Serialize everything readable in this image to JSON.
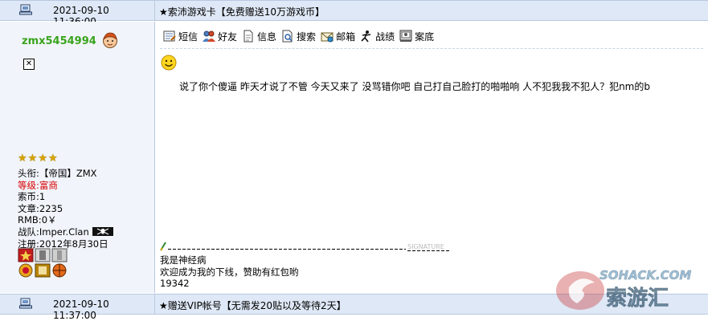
{
  "header_top": {
    "date": "2021-09-10 11:36:00",
    "title": "★索沛游戏卡【免费赠送10万游戏币】"
  },
  "header_bottom": {
    "date": "2021-09-10 11:37:00",
    "title": "★赠送VIP帐号【无需发20贴以及等待2天】"
  },
  "user": {
    "name": "zmx5454994",
    "stars": [
      "★",
      "★",
      "★",
      "★"
    ],
    "broken_image_mark": "✕",
    "info": [
      {
        "label": "头衔:",
        "value": "【帝国】ZMX",
        "highlight": false
      },
      {
        "label": "等级:",
        "value": "富商",
        "highlight": true
      },
      {
        "label": "索币:",
        "value": "1",
        "highlight": false
      },
      {
        "label": "文章:",
        "value": "2235",
        "highlight": false
      },
      {
        "label": "RMB:",
        "value": "0￥",
        "highlight": false
      },
      {
        "label": "战队:",
        "value": "Imper.Clan",
        "highlight": false
      },
      {
        "label": "注册:",
        "value": "2012年8月30日",
        "highlight": false
      }
    ]
  },
  "toolbar": [
    {
      "label": "短信",
      "icon": "message-icon"
    },
    {
      "label": "好友",
      "icon": "friends-icon"
    },
    {
      "label": "信息",
      "icon": "info-icon"
    },
    {
      "label": "搜索",
      "icon": "search-icon"
    },
    {
      "label": "邮箱",
      "icon": "mail-icon"
    },
    {
      "label": "战绩",
      "icon": "record-icon"
    },
    {
      "label": "案底",
      "icon": "archive-icon"
    }
  ],
  "post": {
    "text": "说了你个傻逼 昨天才说了不管 今天又来了 没骂错你吧 自己打自己脸打的啪啪响 人不犯我我不犯人？犯nm的b"
  },
  "signature": {
    "label": "SIGNATURE",
    "lines": [
      "我是神经病",
      "欢迎成为我的下线，赞助有红包哟",
      "19342"
    ]
  },
  "watermark": {
    "text": "SOHACK.COM",
    "cn": "索游汇"
  },
  "colors": {
    "header_bg": "#dfe8f6",
    "left_panel_bg": "#f1f5fb",
    "username": "#3aa31c",
    "highlight": "#d80000",
    "border": "#b8c8e0"
  }
}
